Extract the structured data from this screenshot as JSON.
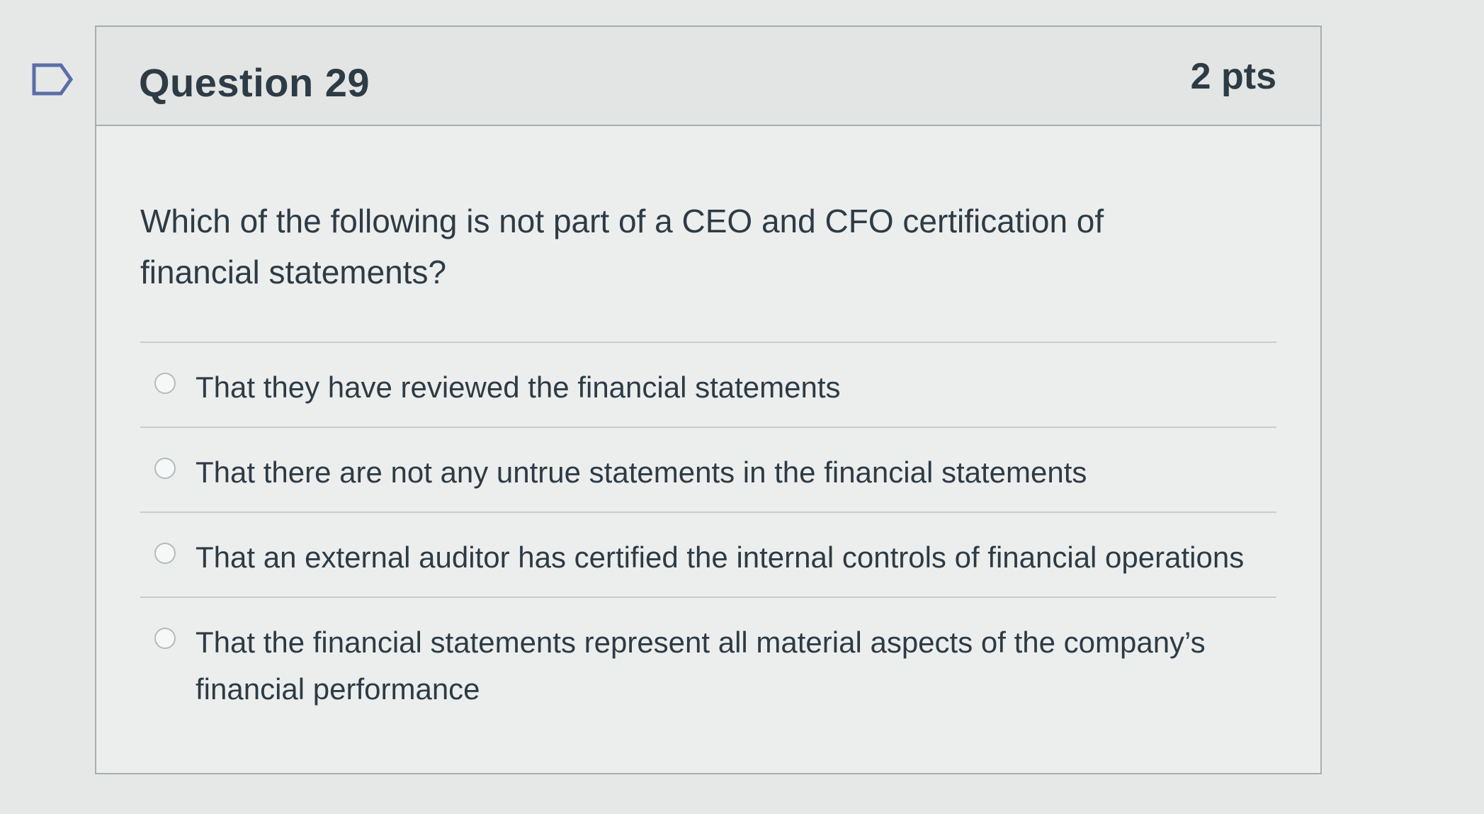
{
  "question": {
    "title": "Question 29",
    "points": "2 pts",
    "text": "Which of the following is not part of a CEO and CFO certification of financial statements?",
    "flag_icon": "flag-outline-icon"
  },
  "answers": [
    {
      "label": "That they have reviewed the financial statements",
      "selected": false
    },
    {
      "label": "That there are not any untrue statements in the financial statements",
      "selected": false
    },
    {
      "label": "That an external auditor has certified the internal controls of financial operations",
      "selected": false
    },
    {
      "label": "That the financial statements represent all material aspects of the company’s financial performance",
      "selected": false
    }
  ],
  "colors": {
    "text": "#2d3b45",
    "border": "#a9aeb1",
    "flag": "#5a6ea8"
  }
}
